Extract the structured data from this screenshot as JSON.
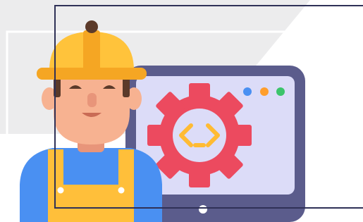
{
  "illustration": {
    "subject": "worker-with-monitor",
    "icons": [
      "hard-hat-icon",
      "gear-icon",
      "code-brackets-icon",
      "window-dots-icon"
    ]
  },
  "colors": {
    "background": "#ffffff",
    "backdrop_gray": "#ececed",
    "frame_line": "#2f3157",
    "monitor_bezel": "#5b5c8c",
    "monitor_screen": "#dcdcf8",
    "gear_red": "#ec4a5f",
    "code_bracket": "#ffbb33",
    "dot_blue": "#4a90f2",
    "dot_orange": "#ff9e2c",
    "dot_green": "#3cc46b",
    "helmet_yellow": "#ffc33b",
    "helmet_shade": "#f5a623",
    "skin": "#f7b291",
    "skin_shade": "#e8957a",
    "hair": "#5b3a2a",
    "shirt_blue": "#4a90f2",
    "overalls_yellow": "#ffbf3a"
  }
}
